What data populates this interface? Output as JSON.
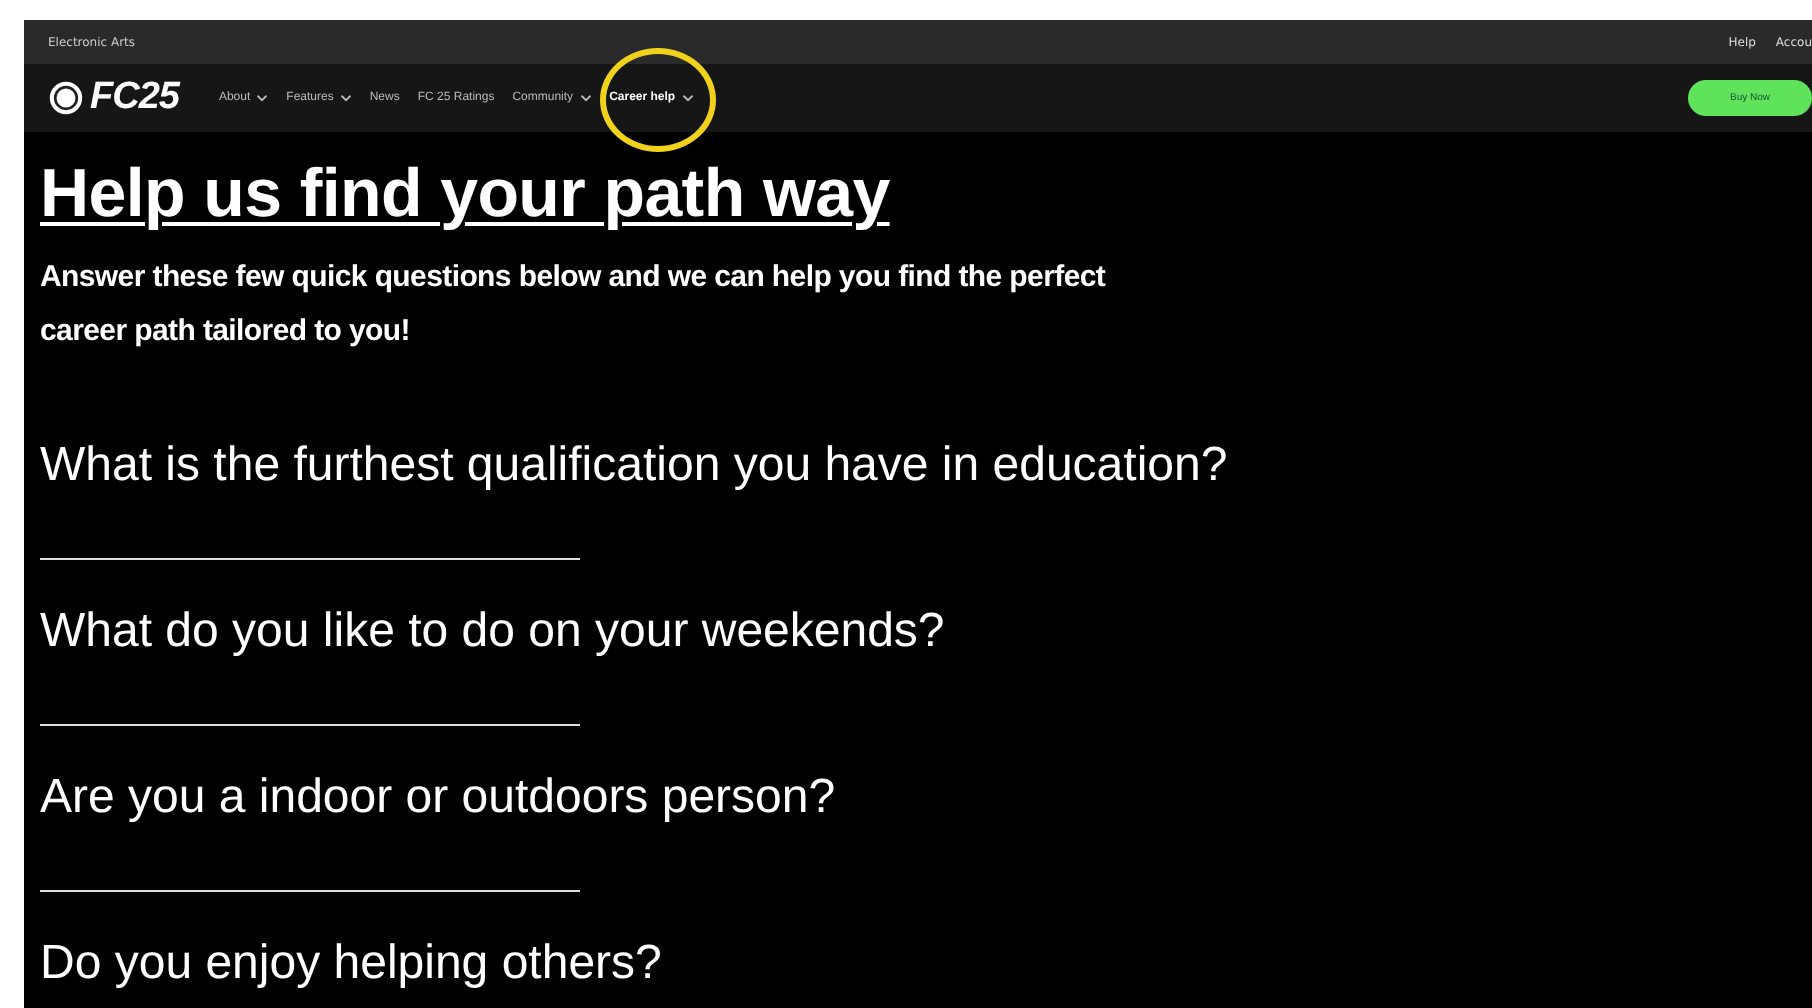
{
  "top_bar": {
    "brand": "Electronic Arts",
    "links": [
      "Help",
      "Accou"
    ]
  },
  "nav": {
    "logo": "FC25",
    "items": [
      {
        "label": "About",
        "dropdown": true,
        "highlighted": false
      },
      {
        "label": "Features",
        "dropdown": true,
        "highlighted": false
      },
      {
        "label": "News",
        "dropdown": false,
        "highlighted": false
      },
      {
        "label": "FC 25 Ratings",
        "dropdown": false,
        "highlighted": false
      },
      {
        "label": "Community",
        "dropdown": true,
        "highlighted": false
      },
      {
        "label": "Career help",
        "dropdown": true,
        "highlighted": true
      }
    ],
    "button": "Buy Now"
  },
  "heading": "Help us find your path way",
  "intro": "Answer these few quick questions below and we can help you find the perfect career path tailored to you!",
  "form": [
    {
      "kind": "question",
      "text": "What is the furthest qualification you have in education?"
    },
    {
      "kind": "answer_line"
    },
    {
      "kind": "question",
      "text": "What do you like to do on your weekends?"
    },
    {
      "kind": "answer_line"
    },
    {
      "kind": "question",
      "text": "Are you a indoor or outdoors person?"
    },
    {
      "kind": "answer_line"
    },
    {
      "kind": "question",
      "text": "Do you enjoy helping others?"
    }
  ]
}
